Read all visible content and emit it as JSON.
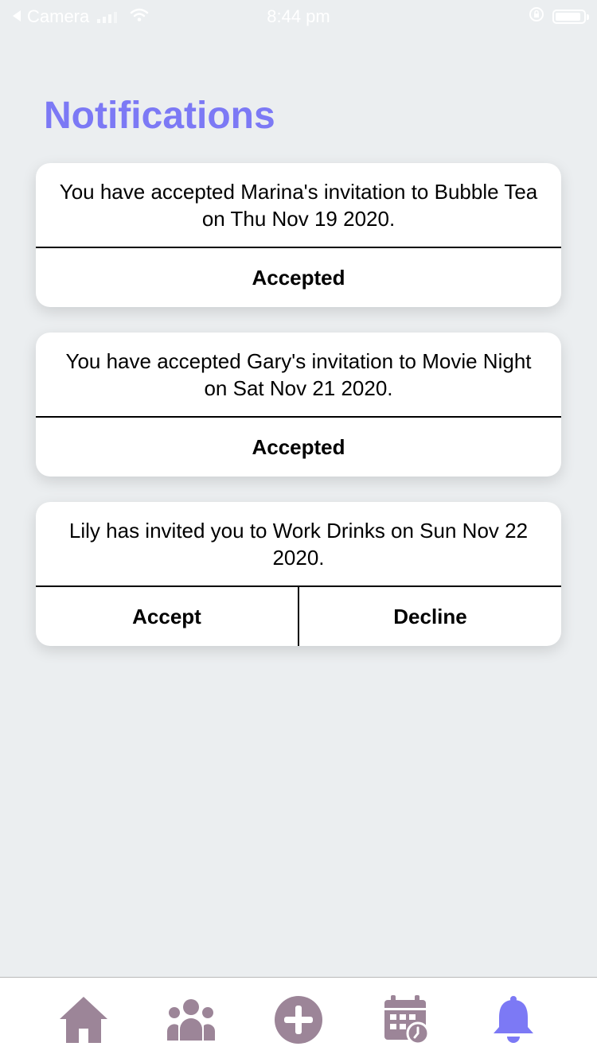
{
  "status_bar": {
    "back_app": "Camera",
    "time": "8:44 pm"
  },
  "page_title": "Notifications",
  "notifications": [
    {
      "message": "You have accepted Marina's invitation to Bubble Tea on Thu Nov 19 2020.",
      "actions": [
        "Accepted"
      ]
    },
    {
      "message": "You have accepted Gary's invitation to Movie Night on Sat Nov 21 2020.",
      "actions": [
        "Accepted"
      ]
    },
    {
      "message": "Lily has invited you to Work Drinks on Sun Nov 22 2020.",
      "actions": [
        "Accept",
        "Decline"
      ]
    }
  ],
  "tab_bar": {
    "tabs": [
      {
        "icon": "home-icon",
        "active": false
      },
      {
        "icon": "group-icon",
        "active": false
      },
      {
        "icon": "add-circle-icon",
        "active": false
      },
      {
        "icon": "calendar-clock-icon",
        "active": false
      },
      {
        "icon": "bell-icon",
        "active": true
      }
    ]
  },
  "colors": {
    "accent": "#7c79f5",
    "inactive_icon": "#9c8598",
    "background": "#ebeef0"
  }
}
